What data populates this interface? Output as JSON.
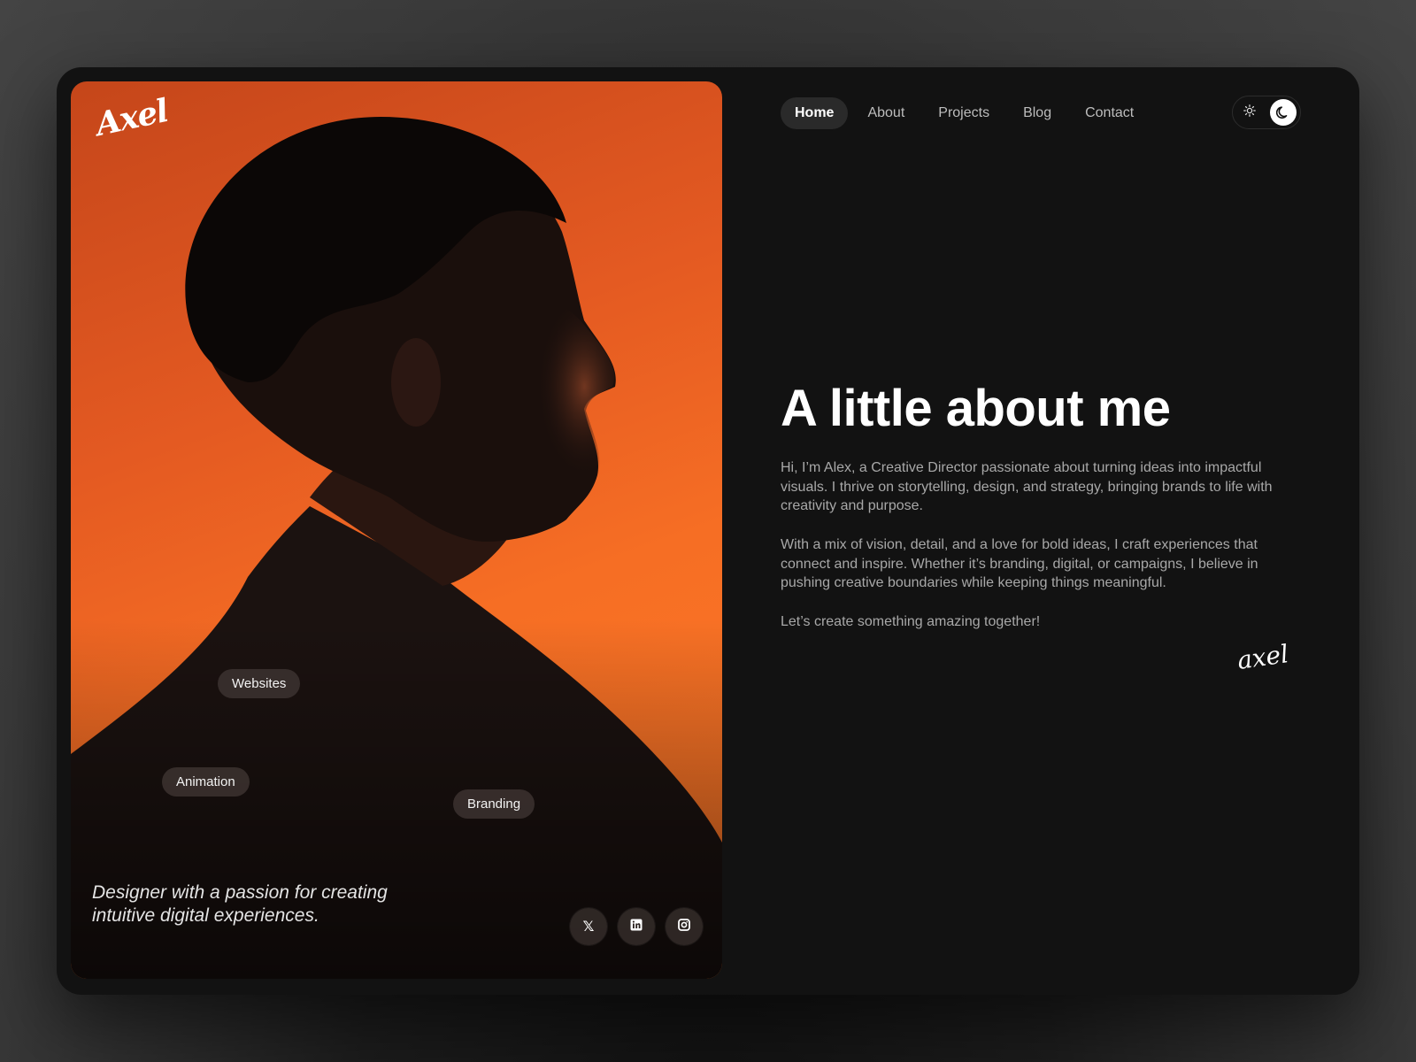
{
  "brand": {
    "logo_text": "Axel",
    "signature_text": "axel"
  },
  "nav": {
    "items": [
      {
        "label": "Home",
        "active": true
      },
      {
        "label": "About",
        "active": false
      },
      {
        "label": "Projects",
        "active": false
      },
      {
        "label": "Blog",
        "active": false
      },
      {
        "label": "Contact",
        "active": false
      }
    ]
  },
  "theme_toggle": {
    "current": "dark",
    "icons": [
      "sun-icon",
      "moon-icon"
    ]
  },
  "hero": {
    "tags": [
      "Websites",
      "Animation",
      "Branding"
    ],
    "tagline": "Designer with a passion for creating intuitive digital experiences.",
    "socials": [
      {
        "icon": "x-icon",
        "glyph": "𝕏"
      },
      {
        "icon": "linkedin-icon",
        "glyph": "in"
      },
      {
        "icon": "instagram-icon",
        "glyph": ""
      }
    ]
  },
  "about": {
    "title": "A little about me",
    "paragraphs": [
      "Hi, I’m Alex, a Creative Director passionate about turning ideas into impactful visuals. I thrive on storytelling, design, and strategy, bringing brands to life with creativity and purpose.",
      "With a mix of vision, detail, and a love for bold ideas, I craft experiences that connect and inspire. Whether it’s branding, digital, or campaigns, I believe in pushing creative boundaries while keeping things meaningful.",
      "Let’s create something amazing together!"
    ]
  },
  "colors": {
    "accent_orange": "#f66e24",
    "frame_bg": "#121212",
    "text_primary": "#ffffff",
    "text_secondary": "#a8a8a8"
  }
}
